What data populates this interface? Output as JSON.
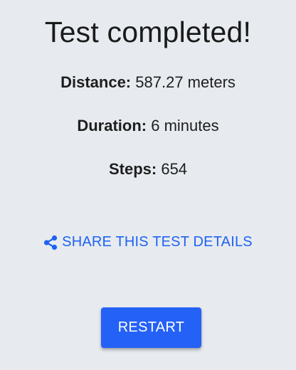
{
  "title": "Test completed!",
  "stats": {
    "distance": {
      "label": "Distance:",
      "value": "587.27 meters"
    },
    "duration": {
      "label": "Duration:",
      "value": "6 minutes"
    },
    "steps": {
      "label": "Steps:",
      "value": "654"
    }
  },
  "share": {
    "icon": "share-icon",
    "label": "SHARE THIS TEST DETAILS"
  },
  "restart": {
    "label": "RESTART"
  },
  "colors": {
    "background": "#e7ebef",
    "accent": "#2461f6",
    "link": "#1f62f2",
    "text": "#1e1e1e"
  }
}
